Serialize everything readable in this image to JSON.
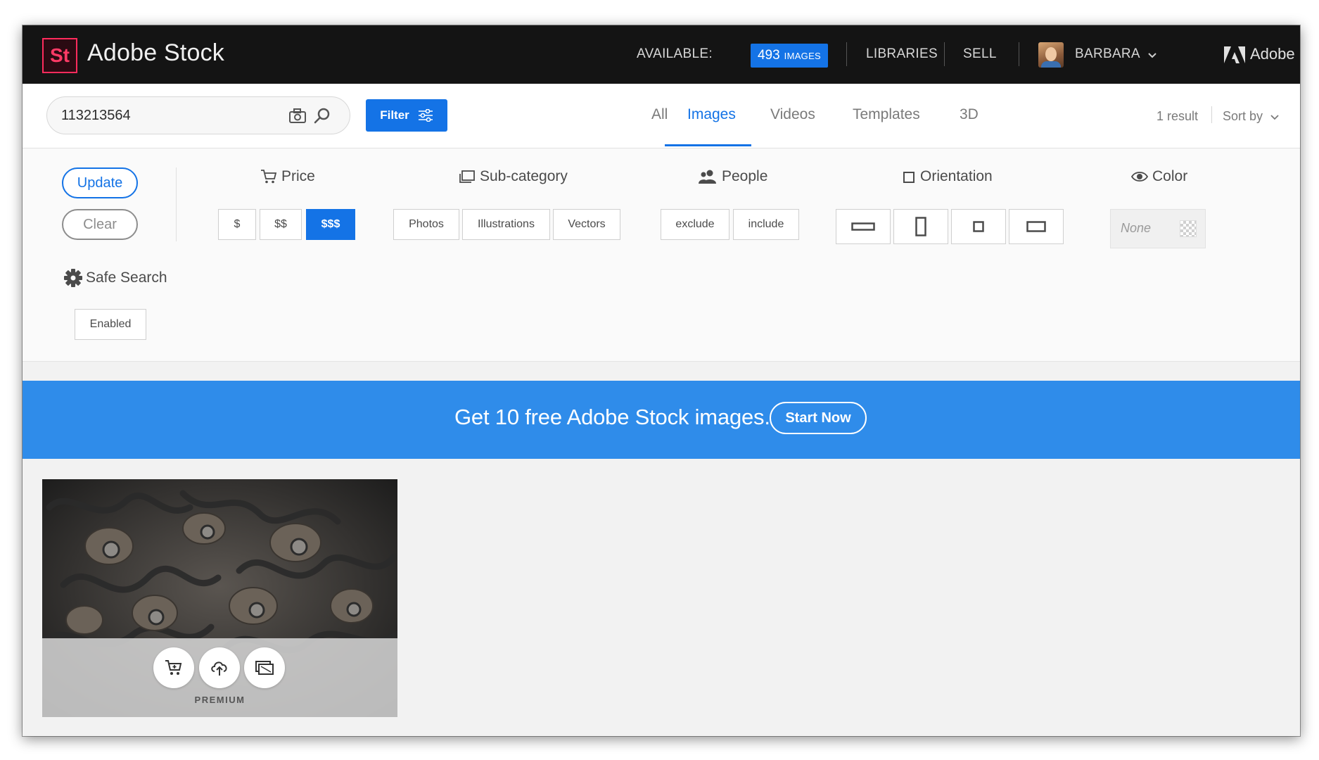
{
  "header": {
    "logo_text": "St",
    "brand": "Adobe Stock",
    "available_label": "AVAILABLE:",
    "images_count": "493",
    "images_unit": "IMAGES",
    "libraries": "LIBRARIES",
    "sell": "SELL",
    "user_name": "BARBARA",
    "adobe": "Adobe"
  },
  "search": {
    "value": "113213564",
    "filter_label": "Filter"
  },
  "tabs": [
    {
      "label": "All",
      "active": false
    },
    {
      "label": "Images",
      "active": true
    },
    {
      "label": "Videos",
      "active": false
    },
    {
      "label": "Templates",
      "active": false
    },
    {
      "label": "3D",
      "active": false
    }
  ],
  "results": {
    "count_text": "1 result",
    "sort_label": "Sort by"
  },
  "filters": {
    "update": "Update",
    "clear": "Clear",
    "price": {
      "title": "Price",
      "options": [
        {
          "label": "$",
          "selected": false
        },
        {
          "label": "$$",
          "selected": false
        },
        {
          "label": "$$$",
          "selected": true
        }
      ]
    },
    "subcategory": {
      "title": "Sub-category",
      "options": [
        "Photos",
        "Illustrations",
        "Vectors"
      ]
    },
    "people": {
      "title": "People",
      "options": [
        "exclude",
        "include"
      ]
    },
    "orientation": {
      "title": "Orientation",
      "options": [
        "horizontal-icon",
        "vertical-icon",
        "square-icon",
        "panoramic-icon"
      ]
    },
    "color": {
      "title": "Color",
      "value": "None"
    },
    "safe_search": {
      "title": "Safe Search",
      "value": "Enabled"
    }
  },
  "banner": {
    "text": "Get 10 free Adobe Stock images.",
    "button": "Start Now",
    "color": "#2f8cea"
  },
  "result_card": {
    "badge": "PREMIUM",
    "actions": [
      "cart-icon",
      "cloud-upload-icon",
      "preview-icon"
    ]
  },
  "colors": {
    "accent": "#1473e6",
    "topbar": "#141414",
    "logo": "#ff2b5c"
  }
}
